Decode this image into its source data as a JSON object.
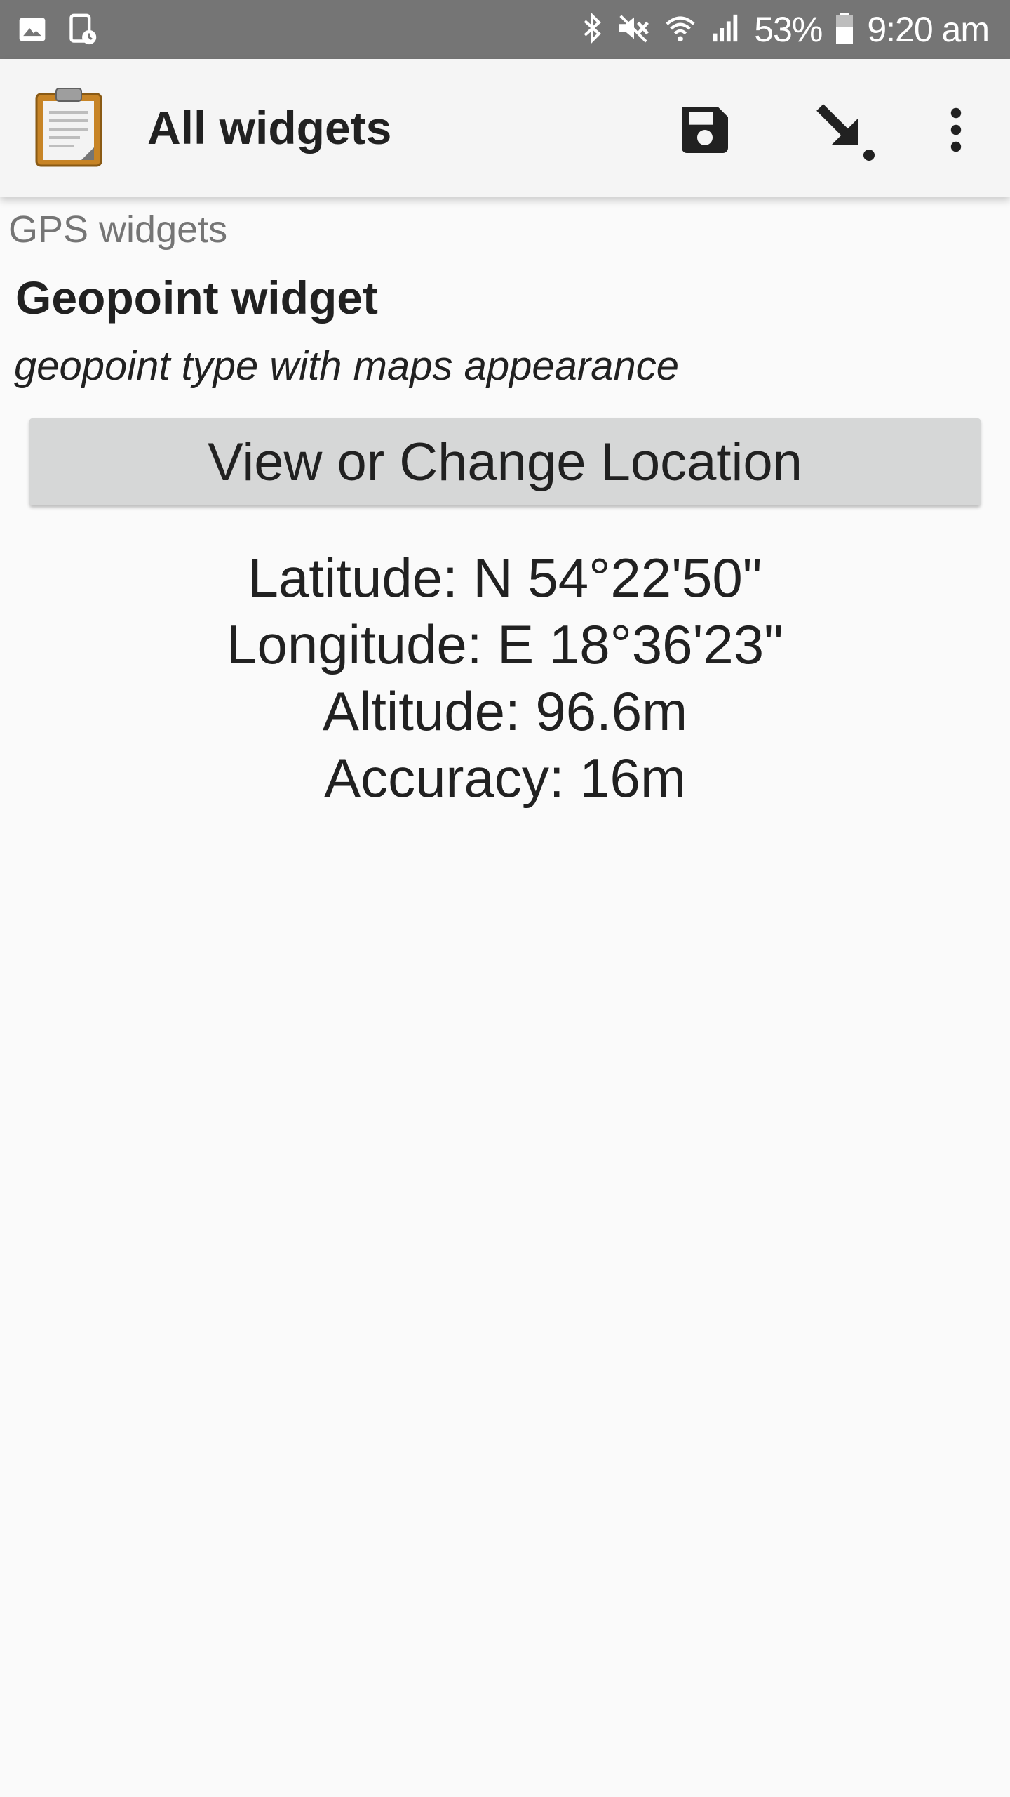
{
  "status_bar": {
    "icons_left": [
      "image-icon",
      "screen-timer-icon"
    ],
    "icons_right": [
      "bluetooth-icon",
      "mute-icon",
      "wifi-icon",
      "signal-icon",
      "battery-icon"
    ],
    "battery_percent": "53%",
    "time": "9:20 am"
  },
  "toolbar": {
    "title": "All widgets",
    "actions": [
      "save-icon",
      "jump-to-icon",
      "more-options-icon"
    ]
  },
  "form": {
    "group_label": "GPS widgets",
    "question_label": "Geopoint widget",
    "question_hint": "geopoint type with maps appearance",
    "button_label": "View or Change Location",
    "latitude": "Latitude: N 54°22'50\"",
    "longitude": "Longitude: E 18°36'23\"",
    "altitude": "Altitude: 96.6m",
    "accuracy": "Accuracy: 16m"
  },
  "colors": {
    "status_bar": "#757575",
    "toolbar": "#f5f5f5",
    "background": "#fafafa",
    "button": "#d6d7d7",
    "text": "#212121",
    "secondary_text": "#757575"
  }
}
